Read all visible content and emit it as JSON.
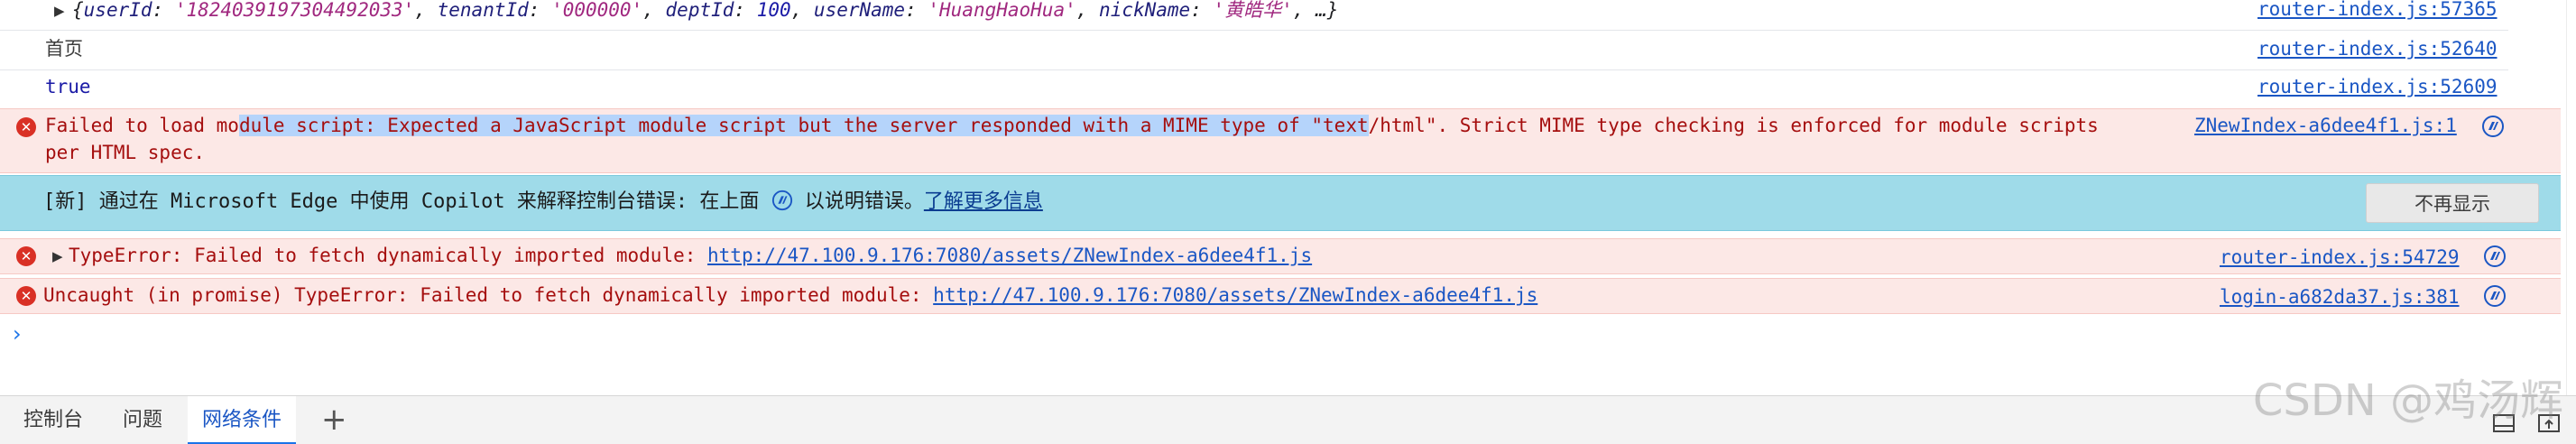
{
  "console": {
    "object_row": {
      "expand_glyph": "▶",
      "open_brace": "{",
      "fields": [
        {
          "key": "userId",
          "value": "'1824039197304492033'",
          "kind": "str"
        },
        {
          "key": "tenantId",
          "value": "'000000'",
          "kind": "str"
        },
        {
          "key": "deptId",
          "value": "100",
          "kind": "num"
        },
        {
          "key": "userName",
          "value": "'HuangHaoHua'",
          "kind": "str"
        },
        {
          "key": "nickName",
          "value": "'黄皓华'",
          "kind": "str"
        }
      ],
      "tail": ", …}",
      "source": "router-index.js:57365"
    },
    "home_row": {
      "text": "首页",
      "source": "router-index.js:52640"
    },
    "true_row": {
      "text": "true",
      "source": "router-index.js:52609"
    },
    "mime_error": {
      "icon": "✕",
      "line1_pre": "Failed to load mo",
      "line1_hl": "dule script: Expected a JavaScript module script but the server responded with a MIME type of \"text",
      "line1_post": "/html\". Strict MIME type checking is enforced for module scripts",
      "line2": "per HTML spec.",
      "source": "ZNewIndex-a6dee4f1.js:1"
    },
    "banner": {
      "prefix": "[新] 通过在 Microsoft Edge 中使用 Copilot 来解释控制台错误: 在上面 ",
      "suffix": " 以说明错误。",
      "link": "了解更多信息",
      "dismiss": "不再显示"
    },
    "type_error": {
      "icon": "✕",
      "expand_glyph": "▶",
      "text": "TypeError: Failed to fetch dynamically imported module: ",
      "url": "http://47.100.9.176:7080/assets/ZNewIndex-a6dee4f1.js",
      "source": "router-index.js:54729"
    },
    "uncaught_error": {
      "icon": "✕",
      "text": "Uncaught (in promise) TypeError: Failed to fetch dynamically imported module: ",
      "url": "http://47.100.9.176:7080/assets/ZNewIndex-a6dee4f1.js",
      "source": "login-a682da37.js:381"
    },
    "prompt": "›"
  },
  "drawer": {
    "tabs": [
      {
        "label": "控制台",
        "active": false
      },
      {
        "label": "问题",
        "active": false
      },
      {
        "label": "网络条件",
        "active": true
      }
    ],
    "add": "+"
  },
  "watermark": "CSDN @鸡汤辉",
  "colors": {
    "error_bg": "#fce8e6",
    "error_text": "#a50e0e",
    "link": "#1a56c4",
    "banner_bg": "#9fdbe9",
    "selection": "#b5d4fb",
    "accent": "#1a73e8"
  }
}
